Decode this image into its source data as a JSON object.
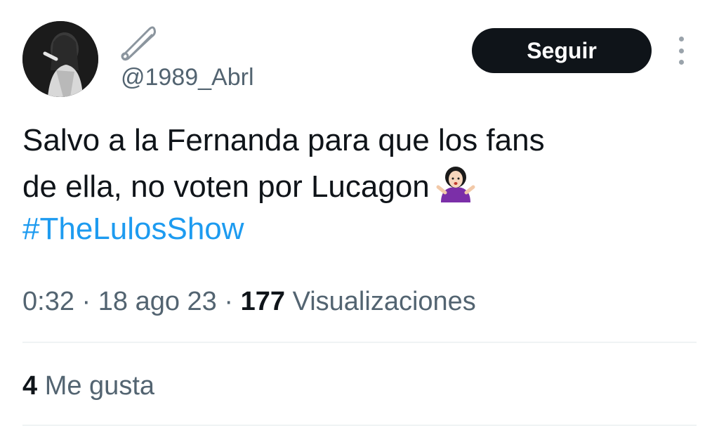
{
  "user": {
    "name_icon": "safety-pin-icon",
    "handle": "@1989_Abrl",
    "avatar": "avatar"
  },
  "follow_button": {
    "label": "Seguir"
  },
  "more_icon": "more-vertical-icon",
  "tweet": {
    "line1": "Salvo a la Fernanda para que los fans",
    "line2": "de ella, no voten por Lucagon",
    "emoji": "person-shrugging-emoji",
    "hashtag": "#TheLulosShow"
  },
  "meta": {
    "time": "0:32",
    "sep": "·",
    "date": "18 ago 23",
    "views_count": "177",
    "views_label": "Visualizaciones"
  },
  "likes": {
    "count": "4",
    "label": "Me gusta"
  },
  "colors": {
    "text": "#0f1419",
    "muted": "#536471",
    "link": "#1d9bf0",
    "button": "#0f1419",
    "divider": "#eff3f4"
  }
}
